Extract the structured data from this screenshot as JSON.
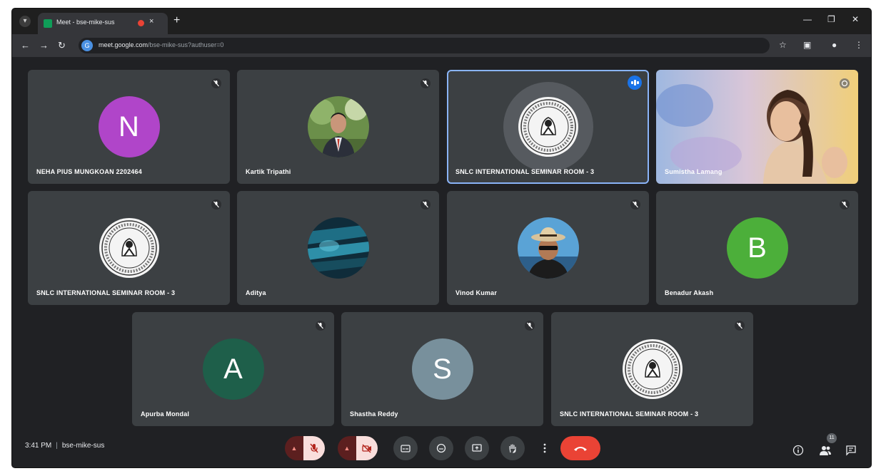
{
  "browser": {
    "tab_title": "Meet - bse-mike-sus",
    "close_glyph": "×",
    "new_tab_glyph": "+",
    "url_host": "meet.google.com",
    "url_path": "/bse-mike-sus?authuser=0",
    "site_icon_letter": "G"
  },
  "tiles": [
    {
      "name": "NEHA PIUS MUNGKOAN 2202464",
      "kind": "letter",
      "letter": "N",
      "color": "#b045c9"
    },
    {
      "name": "Kartik Tripathi",
      "kind": "photo-man"
    },
    {
      "name": "SNLC INTERNATIONAL SEMINAR ROOM - 3",
      "kind": "logo",
      "speaking": true
    },
    {
      "name": "Sumistha Lamang",
      "kind": "video"
    },
    {
      "name": "SNLC INTERNATIONAL SEMINAR ROOM - 3",
      "kind": "logo"
    },
    {
      "name": "Aditya",
      "kind": "photo-abstract"
    },
    {
      "name": "Vinod Kumar",
      "kind": "photo-hat"
    },
    {
      "name": "Benadur Akash",
      "kind": "letter",
      "letter": "B",
      "color": "#4caf3a"
    },
    {
      "name": "Apurba Mondal",
      "kind": "letter",
      "letter": "A",
      "color": "#1e5f4a"
    },
    {
      "name": "Shastha Reddy",
      "kind": "letter",
      "letter": "S",
      "color": "#78909c"
    },
    {
      "name": "SNLC INTERNATIONAL SEMINAR ROOM - 3",
      "kind": "logo"
    }
  ],
  "toolbar": {
    "time": "3:41 PM",
    "separator": "|",
    "meeting_code": "bse-mike-sus",
    "people_count": "11"
  }
}
